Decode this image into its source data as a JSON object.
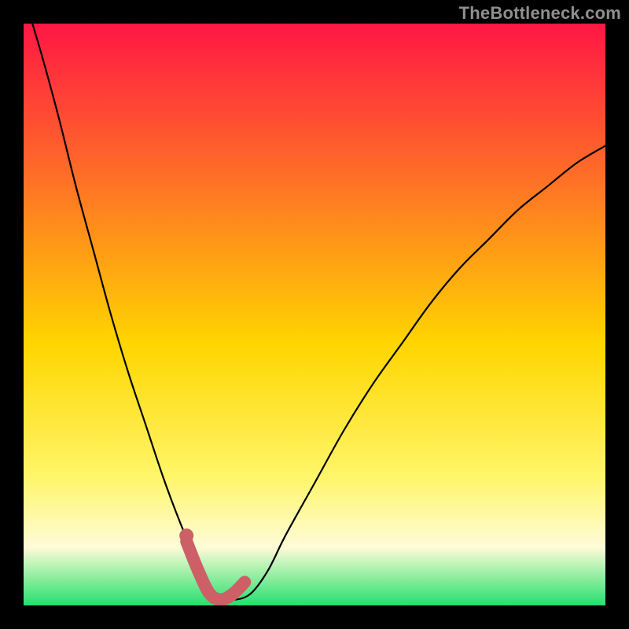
{
  "watermark": "TheBottleneck.com",
  "colors": {
    "frame": "#000000",
    "gradient_top": "#ff1744",
    "gradient_mid_upper": "#ff6a28",
    "gradient_mid": "#ffd500",
    "gradient_mid_lower": "#fff66a",
    "gradient_cream": "#fffbd8",
    "gradient_bottom": "#25e06d",
    "curve_stroke": "#000000",
    "marker_stroke": "#cc6066",
    "marker_fill": "#cc6066"
  },
  "chart_data": {
    "type": "line",
    "title": "",
    "xlabel": "",
    "ylabel": "",
    "xlim": [
      0,
      100
    ],
    "ylim": [
      0,
      100
    ],
    "note": "Value is read as approximate percentage height from bottom (0 = bottom/green, 100 = top/red). Curve drops steeply from left, reaches a flat minimum near x≈30–36, then rises gradually toward the right edge. Highlighted segment near the trough is emphasized in a thick salmon stroke with a dot.",
    "series": [
      {
        "name": "bottleneck-curve",
        "x": [
          0,
          3,
          6,
          9,
          12,
          15,
          18,
          21,
          24,
          27,
          30,
          33,
          36,
          39,
          42,
          45,
          50,
          55,
          60,
          65,
          70,
          75,
          80,
          85,
          90,
          95,
          100
        ],
        "values": [
          105,
          95,
          84,
          72,
          61,
          50,
          40,
          31,
          22,
          14,
          7,
          2,
          1,
          2,
          6,
          12,
          21,
          30,
          38,
          45,
          52,
          58,
          63,
          68,
          72,
          76,
          79
        ]
      }
    ],
    "highlight": {
      "name": "trough-emphasis",
      "x": [
        28,
        30,
        32,
        34,
        36,
        38
      ],
      "values": [
        11,
        6,
        2,
        1,
        2,
        4
      ],
      "dot": {
        "x": 28,
        "value": 12
      }
    }
  }
}
